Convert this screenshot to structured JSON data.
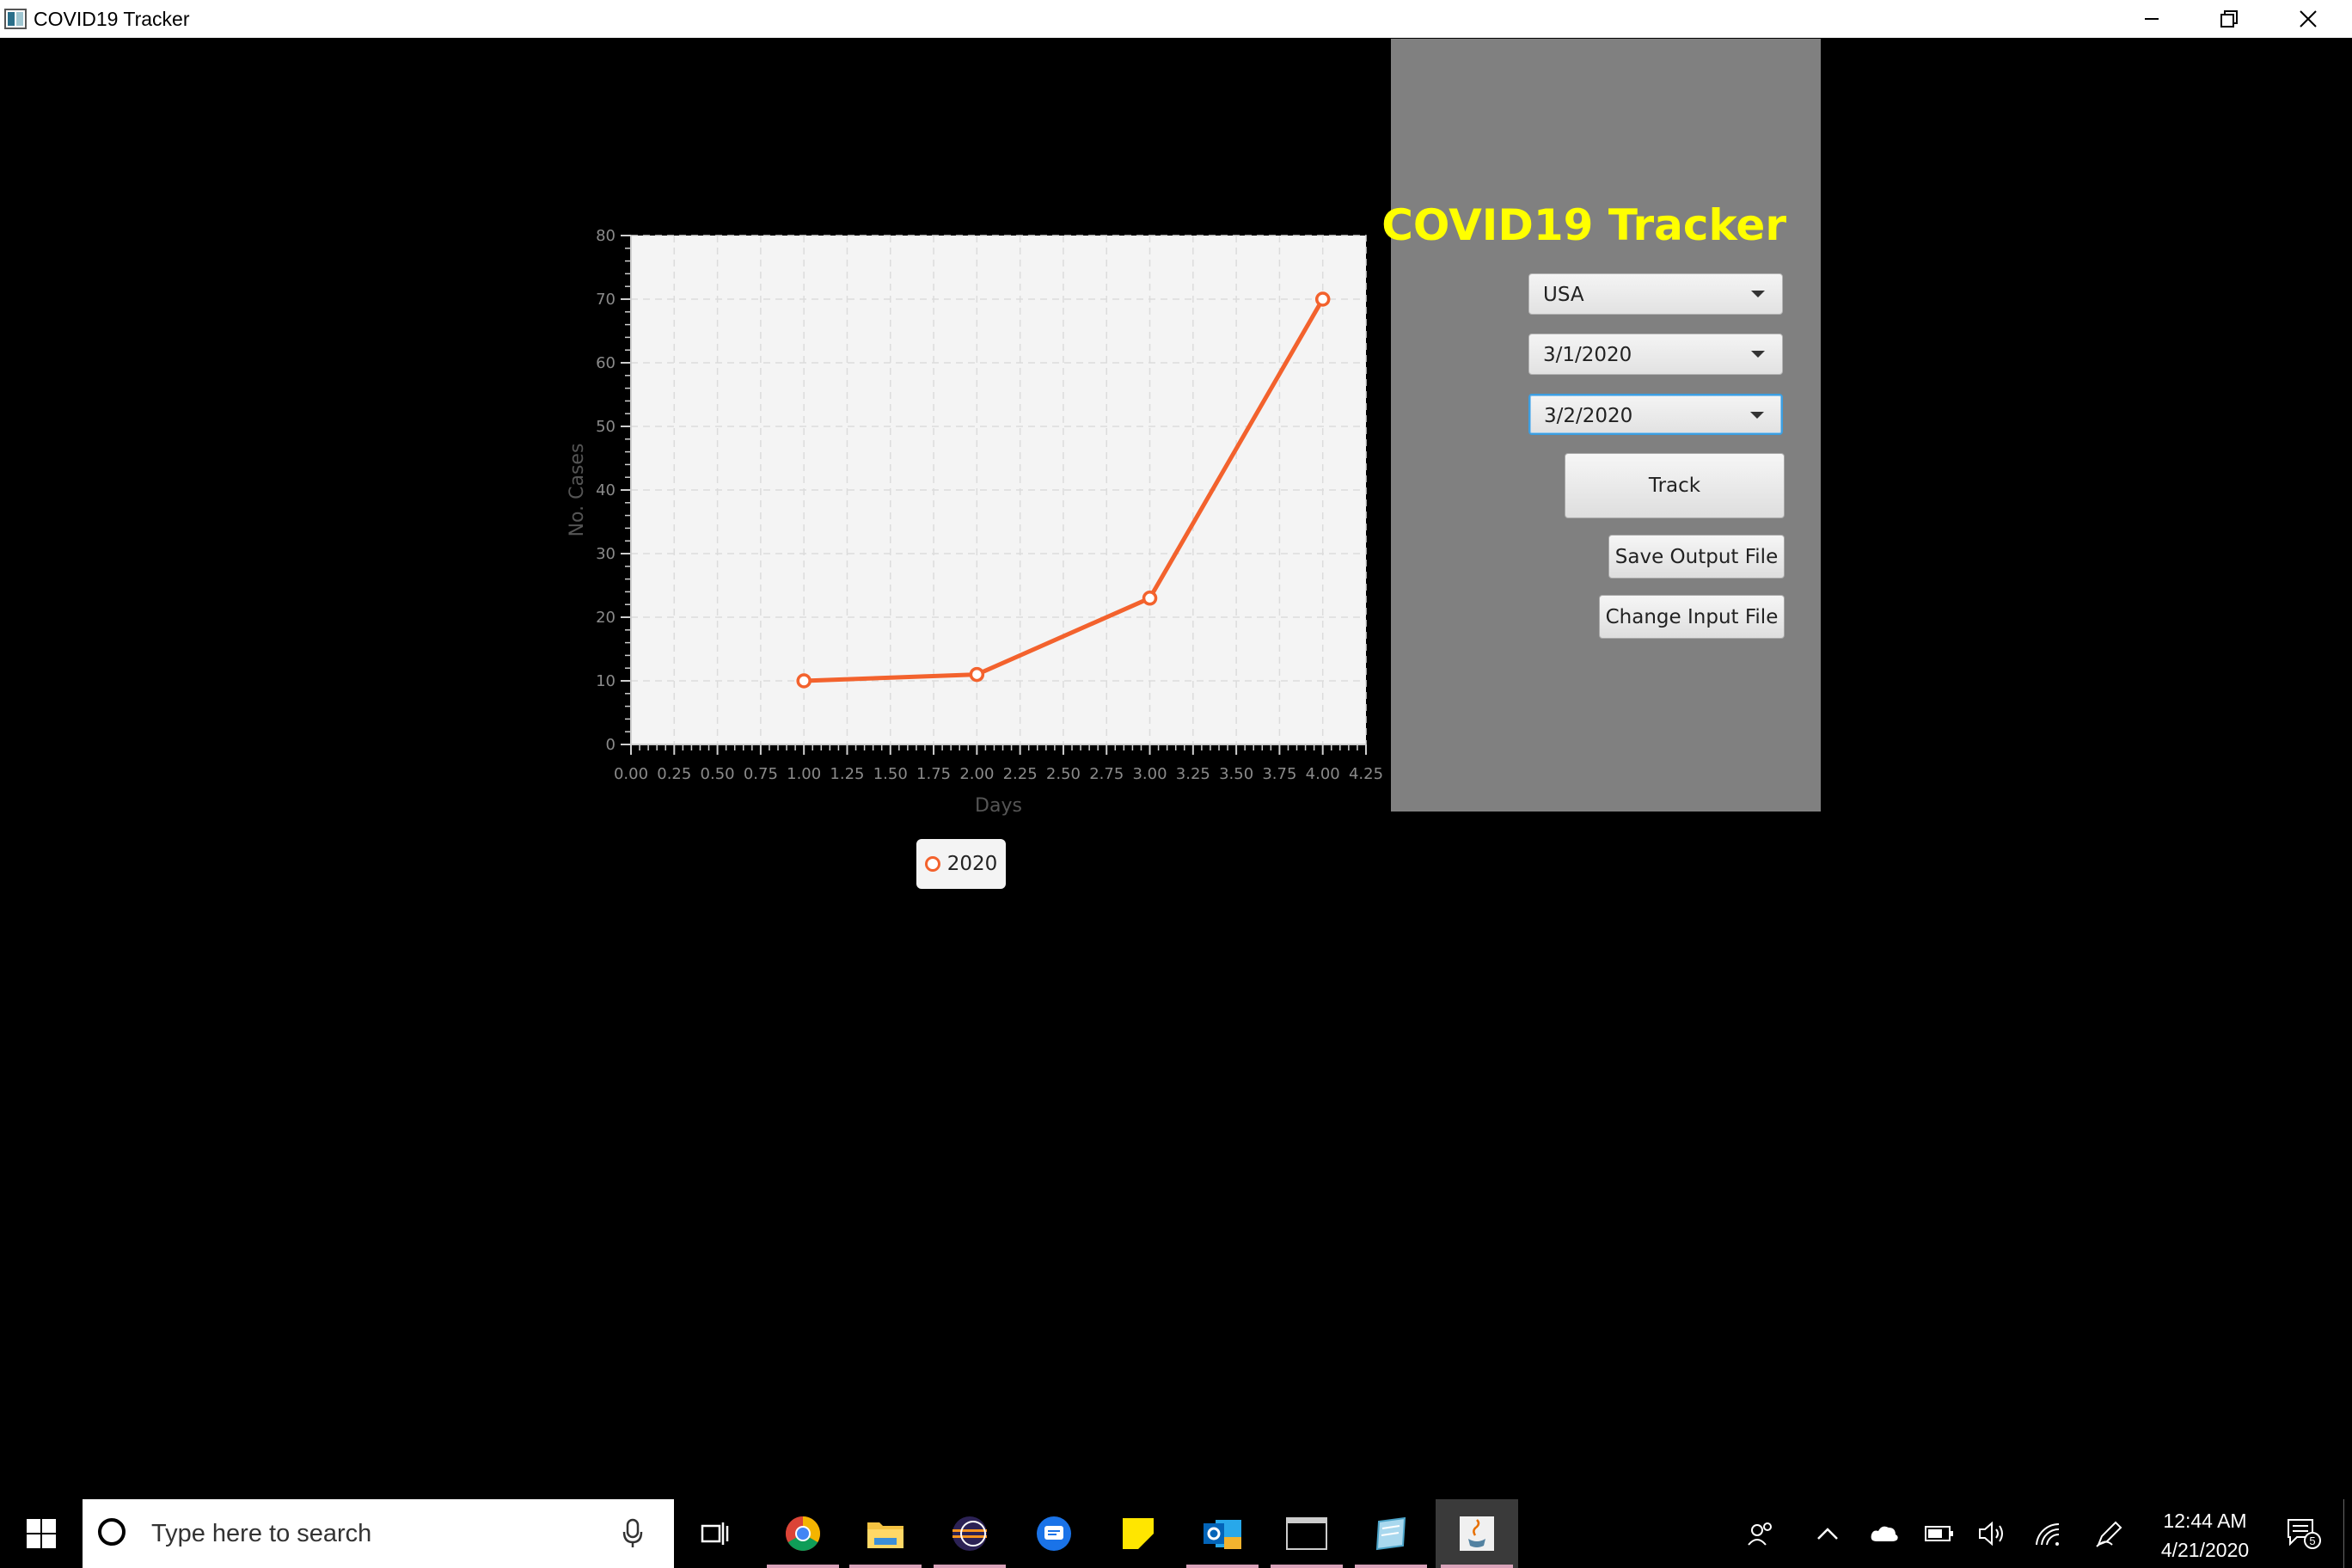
{
  "window": {
    "title": "COVID19 Tracker"
  },
  "panel": {
    "title": "COVID19 Tracker",
    "country_select": "USA",
    "start_date_select": "3/1/2020",
    "end_date_select": "3/2/2020",
    "track_button": "Track",
    "save_button": "Save Output File",
    "change_input_button": "Change Input File"
  },
  "chart_data": {
    "type": "line",
    "xlabel": "Days",
    "ylabel": "No. Cases",
    "xlim": [
      0,
      4.25
    ],
    "ylim": [
      0,
      80
    ],
    "x_ticks": [
      "0.00",
      "0.25",
      "0.50",
      "0.75",
      "1.00",
      "1.25",
      "1.50",
      "1.75",
      "2.00",
      "2.25",
      "2.50",
      "2.75",
      "3.00",
      "3.25",
      "3.50",
      "3.75",
      "4.00",
      "4.25"
    ],
    "y_ticks": [
      "0",
      "10",
      "20",
      "30",
      "40",
      "50",
      "60",
      "70",
      "80"
    ],
    "grid": true,
    "legend_position": "bottom",
    "series": [
      {
        "name": "2020",
        "color": "#f3622d",
        "x": [
          1,
          2,
          3,
          4
        ],
        "y": [
          10,
          11,
          23,
          70
        ]
      }
    ]
  },
  "taskbar": {
    "search_placeholder": "Type here to search",
    "time": "12:44 AM",
    "date": "4/21/2020",
    "notification_count": "5",
    "apps": [
      "task-view",
      "chrome",
      "file-explorer",
      "eclipse",
      "messages",
      "sticky-notes",
      "outlook",
      "terminal",
      "notepad",
      "java"
    ]
  }
}
